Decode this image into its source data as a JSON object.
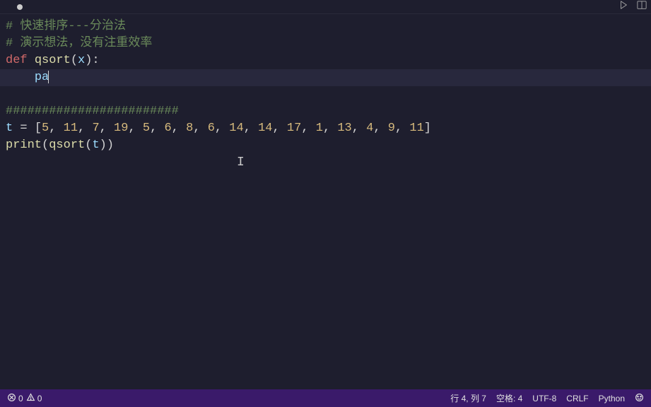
{
  "code": {
    "comment1": "# 快速排序---分治法",
    "comment2": "# 演示想法，没有注重效率",
    "def_kw": "def",
    "func_name": "qsort",
    "param": "x",
    "partial": "pa",
    "hashline": "########################",
    "var_t": "t",
    "list_values": [
      "5",
      "11",
      "7",
      "19",
      "5",
      "6",
      "8",
      "6",
      "14",
      "14",
      "17",
      "1",
      "13",
      "4",
      "9",
      "11"
    ],
    "print_kw": "print",
    "call_func": "qsort",
    "call_arg": "t"
  },
  "statusbar": {
    "errors": "0",
    "warnings": "0",
    "position": "行 4, 列 7",
    "indent": "空格: 4",
    "encoding": "UTF-8",
    "eol": "CRLF",
    "language": "Python"
  }
}
